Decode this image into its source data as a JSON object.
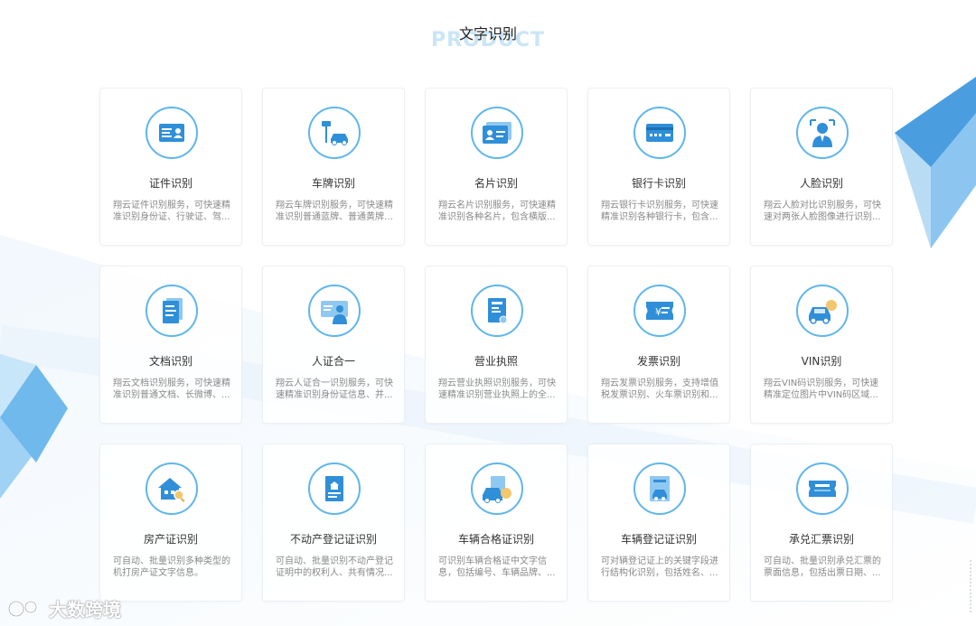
{
  "section": {
    "title": "文字识别",
    "subtitle_en": "PRODUCT"
  },
  "colors": {
    "accent": "#5fb6ec",
    "icon_fill": "#2f8fd8"
  },
  "cards": [
    {
      "title": "证件识别",
      "desc": "翔云证件识别服务，可快速精准识别身份证、行驶证、驾...",
      "icon": "id-card-icon"
    },
    {
      "title": "车牌识别",
      "desc": "翔云车牌识别服务，可快速精准识别普通蓝牌、普通黄牌(...",
      "icon": "license-plate-camera-icon"
    },
    {
      "title": "名片识别",
      "desc": "翔云名片识别服务，可快速精准识别各种名片，包含横版...",
      "icon": "business-card-icon"
    },
    {
      "title": "银行卡识别",
      "desc": "翔云银行卡识别服务，可快速精准识别各种银行卡，包含...",
      "icon": "bank-card-icon"
    },
    {
      "title": "人脸识别",
      "desc": "翔云人脸对比识别服务，可快速对两张人脸图像进行识别...",
      "icon": "face-scan-icon"
    },
    {
      "title": "文档识别",
      "desc": "翔云文档识别服务，可快速精准识别普通文档、长微博、...",
      "icon": "document-icon"
    },
    {
      "title": "人证合一",
      "desc": "翔云人证合一识别服务，可快速精准识别身份证信息、并...",
      "icon": "person-id-icon"
    },
    {
      "title": "营业执照",
      "desc": "翔云营业执照识别服务，可快速精准识别营业执照上的全...",
      "icon": "business-license-icon"
    },
    {
      "title": "发票识别",
      "desc": "翔云发票识别服务，支持增值税发票识别、火车票识别和...",
      "icon": "invoice-icon"
    },
    {
      "title": "VIN识别",
      "desc": "翔云VIN码识别服务，可快速精准定位图片中VIN码区域...",
      "icon": "vin-car-icon"
    },
    {
      "title": "房产证识别",
      "desc": "可自动、批量识别多种类型的机打房产证文字信息。",
      "icon": "house-search-icon"
    },
    {
      "title": "不动产登记证识别",
      "desc": "可自动、批量识别不动产登记证明中的权利人、共有情况...",
      "icon": "property-certificate-icon"
    },
    {
      "title": "车辆合格证识别",
      "desc": "可识别车辆合格证中文字信息，包括编号、车辆品牌、...",
      "icon": "vehicle-certificate-icon"
    },
    {
      "title": "车辆登记证识别",
      "desc": "可对辆登记证上的关键字段进行结构化识别，包括姓名、...",
      "icon": "vehicle-registration-icon"
    },
    {
      "title": "承兑汇票识别",
      "desc": "可自动、批量识别承兑汇票的票面信息，包括出票日期、...",
      "icon": "acceptance-bill-icon"
    }
  ],
  "watermark": {
    "text": "大数跨境"
  }
}
